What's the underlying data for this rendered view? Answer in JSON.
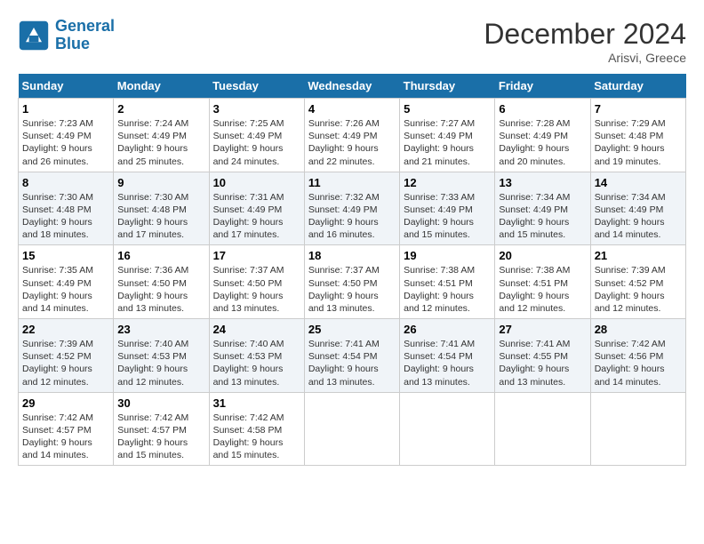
{
  "header": {
    "logo_line1": "General",
    "logo_line2": "Blue",
    "month_title": "December 2024",
    "location": "Arisvi, Greece"
  },
  "weekdays": [
    "Sunday",
    "Monday",
    "Tuesday",
    "Wednesday",
    "Thursday",
    "Friday",
    "Saturday"
  ],
  "weeks": [
    [
      {
        "day": "1",
        "text": "Sunrise: 7:23 AM\nSunset: 4:49 PM\nDaylight: 9 hours\nand 26 minutes."
      },
      {
        "day": "2",
        "text": "Sunrise: 7:24 AM\nSunset: 4:49 PM\nDaylight: 9 hours\nand 25 minutes."
      },
      {
        "day": "3",
        "text": "Sunrise: 7:25 AM\nSunset: 4:49 PM\nDaylight: 9 hours\nand 24 minutes."
      },
      {
        "day": "4",
        "text": "Sunrise: 7:26 AM\nSunset: 4:49 PM\nDaylight: 9 hours\nand 22 minutes."
      },
      {
        "day": "5",
        "text": "Sunrise: 7:27 AM\nSunset: 4:49 PM\nDaylight: 9 hours\nand 21 minutes."
      },
      {
        "day": "6",
        "text": "Sunrise: 7:28 AM\nSunset: 4:49 PM\nDaylight: 9 hours\nand 20 minutes."
      },
      {
        "day": "7",
        "text": "Sunrise: 7:29 AM\nSunset: 4:48 PM\nDaylight: 9 hours\nand 19 minutes."
      }
    ],
    [
      {
        "day": "8",
        "text": "Sunrise: 7:30 AM\nSunset: 4:48 PM\nDaylight: 9 hours\nand 18 minutes."
      },
      {
        "day": "9",
        "text": "Sunrise: 7:30 AM\nSunset: 4:48 PM\nDaylight: 9 hours\nand 17 minutes."
      },
      {
        "day": "10",
        "text": "Sunrise: 7:31 AM\nSunset: 4:49 PM\nDaylight: 9 hours\nand 17 minutes."
      },
      {
        "day": "11",
        "text": "Sunrise: 7:32 AM\nSunset: 4:49 PM\nDaylight: 9 hours\nand 16 minutes."
      },
      {
        "day": "12",
        "text": "Sunrise: 7:33 AM\nSunset: 4:49 PM\nDaylight: 9 hours\nand 15 minutes."
      },
      {
        "day": "13",
        "text": "Sunrise: 7:34 AM\nSunset: 4:49 PM\nDaylight: 9 hours\nand 15 minutes."
      },
      {
        "day": "14",
        "text": "Sunrise: 7:34 AM\nSunset: 4:49 PM\nDaylight: 9 hours\nand 14 minutes."
      }
    ],
    [
      {
        "day": "15",
        "text": "Sunrise: 7:35 AM\nSunset: 4:49 PM\nDaylight: 9 hours\nand 14 minutes."
      },
      {
        "day": "16",
        "text": "Sunrise: 7:36 AM\nSunset: 4:50 PM\nDaylight: 9 hours\nand 13 minutes."
      },
      {
        "day": "17",
        "text": "Sunrise: 7:37 AM\nSunset: 4:50 PM\nDaylight: 9 hours\nand 13 minutes."
      },
      {
        "day": "18",
        "text": "Sunrise: 7:37 AM\nSunset: 4:50 PM\nDaylight: 9 hours\nand 13 minutes."
      },
      {
        "day": "19",
        "text": "Sunrise: 7:38 AM\nSunset: 4:51 PM\nDaylight: 9 hours\nand 12 minutes."
      },
      {
        "day": "20",
        "text": "Sunrise: 7:38 AM\nSunset: 4:51 PM\nDaylight: 9 hours\nand 12 minutes."
      },
      {
        "day": "21",
        "text": "Sunrise: 7:39 AM\nSunset: 4:52 PM\nDaylight: 9 hours\nand 12 minutes."
      }
    ],
    [
      {
        "day": "22",
        "text": "Sunrise: 7:39 AM\nSunset: 4:52 PM\nDaylight: 9 hours\nand 12 minutes."
      },
      {
        "day": "23",
        "text": "Sunrise: 7:40 AM\nSunset: 4:53 PM\nDaylight: 9 hours\nand 12 minutes."
      },
      {
        "day": "24",
        "text": "Sunrise: 7:40 AM\nSunset: 4:53 PM\nDaylight: 9 hours\nand 13 minutes."
      },
      {
        "day": "25",
        "text": "Sunrise: 7:41 AM\nSunset: 4:54 PM\nDaylight: 9 hours\nand 13 minutes."
      },
      {
        "day": "26",
        "text": "Sunrise: 7:41 AM\nSunset: 4:54 PM\nDaylight: 9 hours\nand 13 minutes."
      },
      {
        "day": "27",
        "text": "Sunrise: 7:41 AM\nSunset: 4:55 PM\nDaylight: 9 hours\nand 13 minutes."
      },
      {
        "day": "28",
        "text": "Sunrise: 7:42 AM\nSunset: 4:56 PM\nDaylight: 9 hours\nand 14 minutes."
      }
    ],
    [
      {
        "day": "29",
        "text": "Sunrise: 7:42 AM\nSunset: 4:57 PM\nDaylight: 9 hours\nand 14 minutes."
      },
      {
        "day": "30",
        "text": "Sunrise: 7:42 AM\nSunset: 4:57 PM\nDaylight: 9 hours\nand 15 minutes."
      },
      {
        "day": "31",
        "text": "Sunrise: 7:42 AM\nSunset: 4:58 PM\nDaylight: 9 hours\nand 15 minutes."
      },
      null,
      null,
      null,
      null
    ]
  ]
}
